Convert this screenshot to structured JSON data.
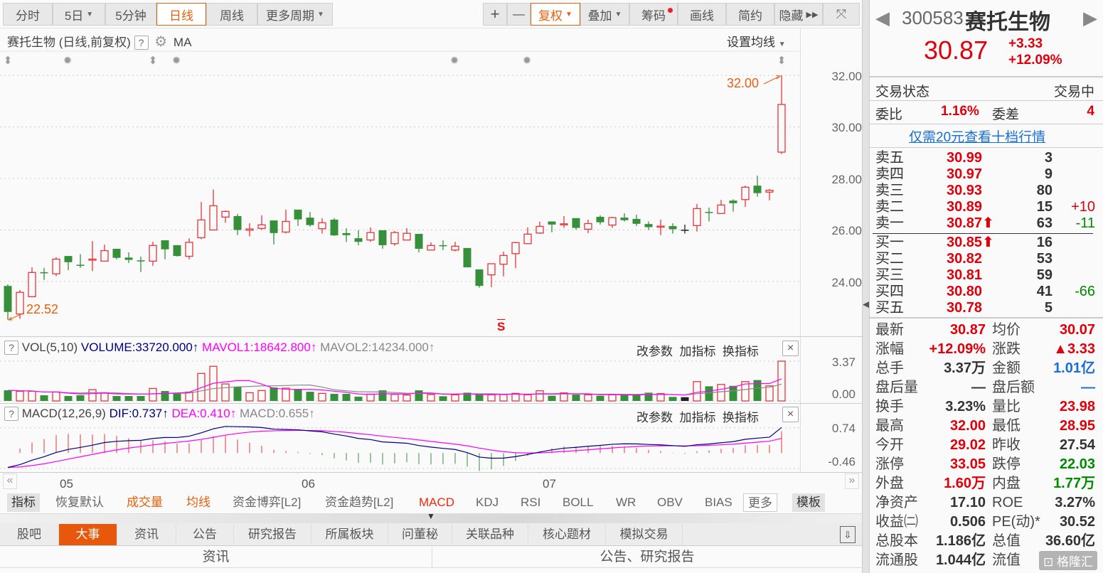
{
  "toolbar": {
    "periods": [
      {
        "label": "分时",
        "dropdown": false,
        "active": false
      },
      {
        "label": "5日",
        "dropdown": true,
        "active": false
      },
      {
        "label": "5分钟",
        "dropdown": false,
        "active": false
      },
      {
        "label": "日线",
        "dropdown": false,
        "active": true
      },
      {
        "label": "周线",
        "dropdown": false,
        "active": false
      },
      {
        "label": "更多周期",
        "dropdown": true,
        "active": false
      }
    ],
    "zoom_in": "+",
    "zoom_out": "—",
    "fuquan": "复权",
    "overlay": "叠加",
    "chips": "筹码",
    "draw": "画线",
    "simple": "简约",
    "hide": "隐藏"
  },
  "chart_header": {
    "title": "赛托生物 (日线,前复权)",
    "help": "?",
    "indicator": "MA",
    "set_ma": "设置均线"
  },
  "price_axis": [
    "32.00",
    "30.00",
    "28.00",
    "26.00",
    "24.00"
  ],
  "annotations": {
    "high": "32.00",
    "low": "22.52",
    "signal": "S"
  },
  "volume_panel": {
    "help": "?",
    "name": "VOL(5,10)",
    "volume": "VOLUME:33720.000",
    "mavol1": "MAVOL1:18642.800",
    "mavol2": "MAVOL2:14234.000",
    "arrow": "↑",
    "params": "改参数",
    "add": "加指标",
    "switch": "换指标",
    "close": "×",
    "axis": [
      "3.37",
      "0.00"
    ]
  },
  "macd_panel": {
    "help": "?",
    "name": "MACD(12,26,9)",
    "dif": "DIF:0.737",
    "dea": "DEA:0.410",
    "macd": "MACD:0.655",
    "arrow": "↑",
    "params": "改参数",
    "add": "加指标",
    "switch": "换指标",
    "close": "×",
    "axis": [
      "0.74",
      "-0.46"
    ]
  },
  "date_axis": {
    "labels": [
      "05",
      "06",
      "07"
    ],
    "prev": "«",
    "next": "»"
  },
  "indicator_tabs": [
    "指标",
    "恢复默认",
    "成交量",
    "均线",
    "资金博弈[L2]",
    "资金趋势[L2]",
    "MACD",
    "KDJ",
    "RSI",
    "BOLL",
    "WR",
    "OBV",
    "BIAS",
    "更多",
    "模板"
  ],
  "bottom_tabs": [
    "股吧",
    "大事",
    "资讯",
    "公告",
    "研究报告",
    "所属板块",
    "问董秘",
    "关联品种",
    "核心题材",
    "模拟交易"
  ],
  "bottom_active": "大事",
  "bottom_sections": [
    "资讯",
    "公告、研究报告"
  ],
  "quote": {
    "code": "300583",
    "name": "赛托生物",
    "price": "30.87",
    "change": "+3.33",
    "change_pct": "+12.09%",
    "status_label": "交易状态",
    "status_value": "交易中",
    "weibi_label": "委比",
    "weibi_value": "1.16%",
    "weicha_label": "委差",
    "weicha_value": "4",
    "promo_link": "仅需20元查看十档行情",
    "asks": [
      {
        "label": "卖五",
        "price": "30.99",
        "vol": "3",
        "chg": ""
      },
      {
        "label": "卖四",
        "price": "30.97",
        "vol": "9",
        "chg": ""
      },
      {
        "label": "卖三",
        "price": "30.93",
        "vol": "80",
        "chg": ""
      },
      {
        "label": "卖二",
        "price": "30.89",
        "vol": "15",
        "chg": "+10"
      },
      {
        "label": "卖一",
        "price": "30.87⬆",
        "vol": "63",
        "chg": "-11"
      }
    ],
    "bids": [
      {
        "label": "买一",
        "price": "30.85⬆",
        "vol": "16",
        "chg": ""
      },
      {
        "label": "买二",
        "price": "30.82",
        "vol": "53",
        "chg": ""
      },
      {
        "label": "买三",
        "price": "30.81",
        "vol": "59",
        "chg": ""
      },
      {
        "label": "买四",
        "price": "30.80",
        "vol": "41",
        "chg": "-66"
      },
      {
        "label": "买五",
        "price": "30.78",
        "vol": "5",
        "chg": ""
      }
    ],
    "stats": [
      [
        {
          "label": "最新",
          "value": "30.87",
          "color": "red"
        },
        {
          "label": "均价",
          "value": "30.07",
          "color": "red"
        }
      ],
      [
        {
          "label": "涨幅",
          "value": "+12.09%",
          "color": "red"
        },
        {
          "label": "涨跌",
          "value": "▲3.33",
          "color": "red"
        }
      ],
      [
        {
          "label": "总手",
          "value": "3.37万",
          "color": "dk"
        },
        {
          "label": "金额",
          "value": "1.01亿",
          "color": "blu"
        }
      ],
      [
        {
          "label": "盘后量",
          "value": "—",
          "color": "dk"
        },
        {
          "label": "盘后额",
          "value": "—",
          "color": "blu"
        }
      ],
      [
        {
          "label": "换手",
          "value": "3.23%",
          "color": "dk"
        },
        {
          "label": "量比",
          "value": "23.98",
          "color": "red"
        }
      ],
      [
        {
          "label": "最高",
          "value": "32.00",
          "color": "red"
        },
        {
          "label": "最低",
          "value": "28.95",
          "color": "red"
        }
      ],
      [
        {
          "label": "今开",
          "value": "29.02",
          "color": "red"
        },
        {
          "label": "昨收",
          "value": "27.54",
          "color": "dk"
        }
      ],
      [
        {
          "label": "涨停",
          "value": "33.05",
          "color": "red"
        },
        {
          "label": "跌停",
          "value": "22.03",
          "color": "grn"
        }
      ],
      [
        {
          "label": "外盘",
          "value": "1.60万",
          "color": "red"
        },
        {
          "label": "内盘",
          "value": "1.77万",
          "color": "grn"
        }
      ],
      [
        {
          "label": "净资产",
          "value": "17.10",
          "color": "dk"
        },
        {
          "label": "ROE",
          "value": "3.27%",
          "color": "dk"
        }
      ],
      [
        {
          "label": "收益㈡",
          "value": "0.506",
          "color": "dk"
        },
        {
          "label": "PE(动)*",
          "value": "30.52",
          "color": "dk"
        }
      ],
      [
        {
          "label": "总股本",
          "value": "1.186亿",
          "color": "dk"
        },
        {
          "label": "总值",
          "value": "36.60亿",
          "color": "dk"
        }
      ],
      [
        {
          "label": "流通股",
          "value": "1.044亿",
          "color": "dk"
        },
        {
          "label": "流值",
          "value": "",
          "color": "dk"
        }
      ]
    ],
    "watermark": "格隆汇"
  },
  "colors": {
    "up": "#e8353b",
    "down": "#36903a",
    "flat": "#222222",
    "accent": "#e8600e",
    "mavol1": "#ff00ff",
    "mavol2": "#888888",
    "dif": "#000080",
    "dea": "#ff00ff"
  },
  "chart_data": {
    "type": "candlestick",
    "ohlc": [
      [
        23.83,
        23.89,
        22.52,
        22.82
      ],
      [
        22.74,
        23.67,
        22.55,
        23.58
      ],
      [
        23.41,
        24.55,
        23.41,
        24.35
      ],
      [
        24.36,
        24.53,
        24.06,
        24.32
      ],
      [
        24.3,
        24.94,
        24.21,
        24.87
      ],
      [
        24.99,
        24.99,
        24.44,
        24.75
      ],
      [
        24.65,
        25.06,
        24.53,
        24.62
      ],
      [
        24.83,
        25.57,
        24.4,
        24.87
      ],
      [
        24.79,
        25.43,
        24.79,
        25.2
      ],
      [
        25.27,
        25.27,
        24.86,
        24.92
      ],
      [
        24.93,
        25.13,
        24.72,
        24.84
      ],
      [
        24.82,
        24.97,
        24.37,
        24.8
      ],
      [
        24.79,
        25.54,
        24.61,
        25.4
      ],
      [
        25.6,
        25.6,
        24.86,
        25.25
      ],
      [
        25.41,
        25.41,
        24.97,
        24.99
      ],
      [
        24.98,
        25.68,
        24.86,
        25.52
      ],
      [
        25.7,
        27.09,
        25.64,
        26.39
      ],
      [
        26.0,
        27.57,
        26.0,
        26.94
      ],
      [
        26.5,
        26.76,
        26.28,
        26.72
      ],
      [
        26.54,
        26.62,
        25.8,
        26.0
      ],
      [
        25.99,
        26.26,
        25.75,
        26.04
      ],
      [
        26.06,
        26.57,
        26.0,
        26.2
      ],
      [
        26.37,
        26.37,
        25.44,
        25.88
      ],
      [
        25.92,
        26.79,
        25.86,
        26.33
      ],
      [
        26.79,
        26.79,
        26.16,
        26.41
      ],
      [
        26.48,
        26.7,
        26.13,
        26.19
      ],
      [
        26.05,
        26.46,
        25.86,
        26.28
      ],
      [
        26.4,
        26.46,
        25.77,
        25.79
      ],
      [
        25.88,
        26.07,
        25.53,
        25.8
      ],
      [
        25.68,
        25.99,
        25.41,
        25.54
      ],
      [
        25.61,
        26.1,
        25.54,
        25.9
      ],
      [
        25.99,
        25.99,
        25.27,
        25.41
      ],
      [
        25.47,
        25.96,
        25.39,
        25.9
      ],
      [
        25.61,
        26.07,
        25.61,
        25.87
      ],
      [
        25.85,
        25.85,
        25.13,
        25.27
      ],
      [
        25.22,
        25.52,
        25.2,
        25.4
      ],
      [
        25.41,
        25.6,
        25.22,
        25.39
      ],
      [
        25.22,
        25.54,
        25.17,
        25.37
      ],
      [
        25.3,
        25.3,
        24.55,
        24.55
      ],
      [
        24.47,
        24.47,
        23.76,
        23.83
      ],
      [
        24.26,
        24.69,
        23.78,
        24.69
      ],
      [
        24.67,
        25.16,
        24.2,
        25.01
      ],
      [
        25.08,
        25.54,
        24.52,
        25.51
      ],
      [
        25.47,
        26.1,
        25.47,
        25.84
      ],
      [
        25.88,
        26.32,
        25.85,
        26.14
      ],
      [
        26.33,
        26.33,
        25.91,
        26.21
      ],
      [
        26.22,
        26.54,
        26.08,
        26.24
      ],
      [
        26.46,
        26.46,
        26.01,
        26.08
      ],
      [
        26.03,
        26.4,
        25.88,
        26.25
      ],
      [
        26.51,
        26.57,
        26.21,
        26.3
      ],
      [
        26.19,
        26.51,
        26.08,
        26.48
      ],
      [
        26.48,
        26.65,
        26.33,
        26.38
      ],
      [
        26.43,
        26.59,
        26.15,
        26.24
      ],
      [
        26.23,
        26.33,
        26.0,
        26.11
      ],
      [
        26.13,
        26.4,
        25.8,
        26.15
      ],
      [
        26.15,
        26.26,
        25.86,
        26.03
      ],
      [
        26.01,
        26.21,
        25.86,
        26.01
      ],
      [
        26.17,
        27.01,
        25.94,
        26.83
      ],
      [
        26.7,
        26.87,
        26.33,
        26.68
      ],
      [
        26.64,
        27.17,
        26.64,
        26.97
      ],
      [
        27.14,
        27.19,
        26.71,
        27.04
      ],
      [
        27.18,
        27.72,
        26.9,
        27.66
      ],
      [
        27.72,
        28.11,
        27.29,
        27.43
      ],
      [
        27.47,
        27.59,
        27.15,
        27.54
      ],
      [
        29.02,
        32.0,
        28.95,
        30.87
      ]
    ],
    "volume_wan": [
      0.9,
      0.82,
      0.82,
      0.48,
      0.76,
      0.42,
      0.48,
      0.96,
      0.7,
      0.42,
      0.42,
      0.42,
      1.06,
      0.84,
      0.64,
      0.74,
      2.33,
      2.93,
      1.44,
      1.18,
      0.7,
      0.88,
      1.14,
      1.08,
      1.02,
      0.78,
      0.64,
      0.6,
      0.6,
      0.36,
      0.58,
      0.9,
      0.56,
      0.5,
      0.9,
      0.54,
      0.4,
      0.52,
      0.7,
      0.54,
      0.52,
      0.54,
      0.64,
      0.52,
      0.86,
      0.44,
      0.68,
      0.54,
      0.52,
      0.44,
      0.52,
      0.52,
      0.52,
      0.7,
      0.62,
      0.34,
      0.32,
      1.64,
      1.24,
      1.4,
      1.28,
      1.64,
      1.77,
      1.28,
      3.37
    ],
    "month_starts": [
      4,
      24,
      44
    ],
    "ylim": [
      22.2,
      32.7
    ],
    "volume_ylim": [
      0,
      3.37
    ],
    "macd_ylim": [
      -0.46,
      0.74
    ],
    "grid": true,
    "marker_rows": {
      "split_icon_at": [
        0,
        12,
        64
      ],
      "event_icon_at": [
        5,
        14,
        37,
        43
      ],
      "signal_at": 41
    }
  }
}
